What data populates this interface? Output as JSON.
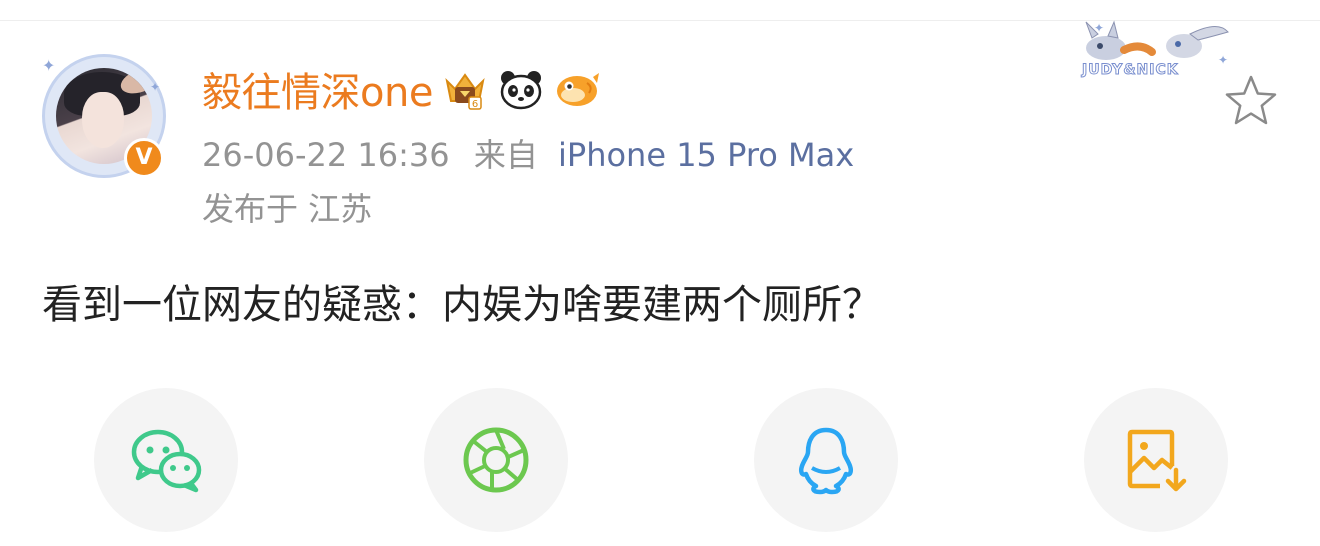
{
  "header": {
    "username": "毅往情深one",
    "timestamp": "26-06-22 16:36",
    "source_prefix": "来自",
    "device": "iPhone 15 Pro Max",
    "location": "发布于 江苏",
    "verified_mark": "V",
    "corner_decoration_text": "JUDY&NICK"
  },
  "post": {
    "text": "看到一位网友的疑惑：内娱为啥要建两个厕所？"
  },
  "share": {
    "buttons": [
      {
        "icon": "wechat-icon",
        "color": "#3fc98b"
      },
      {
        "icon": "moments-icon",
        "color": "#6cc84f"
      },
      {
        "icon": "qq-icon",
        "color": "#2aa6f3"
      },
      {
        "icon": "save-image-icon",
        "color": "#f2a71d"
      }
    ]
  },
  "colors": {
    "username": "#eb7b1f",
    "meta": "#939393",
    "device": "#5b6fa0",
    "text": "#222222"
  }
}
